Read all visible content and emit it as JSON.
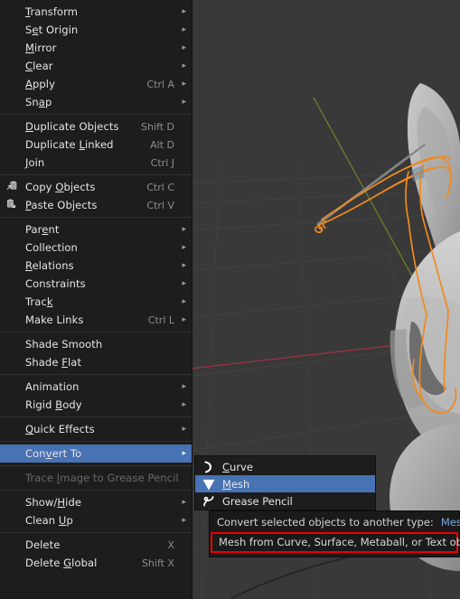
{
  "app": "Blender 3D Viewport - Object menu",
  "viewport": {
    "name": "3d-viewport",
    "background_color": "#393939",
    "grid_color": "#4a4a4a",
    "x_axis_color": "#a33a47",
    "y_axis_color": "#6b7a2a",
    "mesh_color": "#b6b6b6",
    "selection_outline_color": "#f08a1e"
  },
  "menu": {
    "name": "object-context-menu",
    "groups": [
      {
        "items": [
          {
            "label_pre": "",
            "mnemonic": "T",
            "label_post": "ransform",
            "shortcut": "",
            "arrow": true,
            "icon": "",
            "disabled": false,
            "selected": false
          },
          {
            "label_pre": "S",
            "mnemonic": "e",
            "label_post": "t Origin",
            "shortcut": "",
            "arrow": true,
            "icon": "",
            "disabled": false,
            "selected": false
          },
          {
            "label_pre": "",
            "mnemonic": "M",
            "label_post": "irror",
            "shortcut": "",
            "arrow": true,
            "icon": "",
            "disabled": false,
            "selected": false
          },
          {
            "label_pre": "",
            "mnemonic": "C",
            "label_post": "lear",
            "shortcut": "",
            "arrow": true,
            "icon": "",
            "disabled": false,
            "selected": false
          },
          {
            "label_pre": "",
            "mnemonic": "A",
            "label_post": "pply",
            "shortcut": "Ctrl A",
            "arrow": true,
            "icon": "",
            "disabled": false,
            "selected": false
          },
          {
            "label_pre": "Sn",
            "mnemonic": "a",
            "label_post": "p",
            "shortcut": "",
            "arrow": true,
            "icon": "",
            "disabled": false,
            "selected": false
          }
        ]
      },
      {
        "items": [
          {
            "label_pre": "",
            "mnemonic": "D",
            "label_post": "uplicate Objects",
            "shortcut": "Shift D",
            "arrow": false,
            "icon": "",
            "disabled": false,
            "selected": false
          },
          {
            "label_pre": "Duplicate ",
            "mnemonic": "L",
            "label_post": "inked",
            "shortcut": "Alt D",
            "arrow": false,
            "icon": "",
            "disabled": false,
            "selected": false
          },
          {
            "label_pre": "",
            "mnemonic": "J",
            "label_post": "oin",
            "shortcut": "Ctrl J",
            "arrow": false,
            "icon": "",
            "disabled": false,
            "selected": false
          }
        ]
      },
      {
        "items": [
          {
            "label_pre": "Copy ",
            "mnemonic": "O",
            "label_post": "bjects",
            "shortcut": "Ctrl C",
            "arrow": false,
            "icon": "copy-icon",
            "disabled": false,
            "selected": false
          },
          {
            "label_pre": "",
            "mnemonic": "P",
            "label_post": "aste Objects",
            "shortcut": "Ctrl V",
            "arrow": false,
            "icon": "paste-icon",
            "disabled": false,
            "selected": false
          }
        ]
      },
      {
        "items": [
          {
            "label_pre": "Par",
            "mnemonic": "e",
            "label_post": "nt",
            "shortcut": "",
            "arrow": true,
            "icon": "",
            "disabled": false,
            "selected": false
          },
          {
            "label_pre": "Collection",
            "mnemonic": "",
            "label_post": "",
            "shortcut": "",
            "arrow": true,
            "icon": "",
            "disabled": false,
            "selected": false
          },
          {
            "label_pre": "",
            "mnemonic": "R",
            "label_post": "elations",
            "shortcut": "",
            "arrow": true,
            "icon": "",
            "disabled": false,
            "selected": false
          },
          {
            "label_pre": "Constraints",
            "mnemonic": "",
            "label_post": "",
            "shortcut": "",
            "arrow": true,
            "icon": "",
            "disabled": false,
            "selected": false
          },
          {
            "label_pre": "Trac",
            "mnemonic": "k",
            "label_post": "",
            "shortcut": "",
            "arrow": true,
            "icon": "",
            "disabled": false,
            "selected": false
          },
          {
            "label_pre": "Make Links",
            "mnemonic": "",
            "label_post": "",
            "shortcut": "Ctrl L",
            "arrow": true,
            "icon": "",
            "disabled": false,
            "selected": false
          }
        ]
      },
      {
        "items": [
          {
            "label_pre": "Shade Smooth",
            "mnemonic": "",
            "label_post": "",
            "shortcut": "",
            "arrow": false,
            "icon": "",
            "disabled": false,
            "selected": false
          },
          {
            "label_pre": "Shade ",
            "mnemonic": "F",
            "label_post": "lat",
            "shortcut": "",
            "arrow": false,
            "icon": "",
            "disabled": false,
            "selected": false
          }
        ]
      },
      {
        "items": [
          {
            "label_pre": "Animation",
            "mnemonic": "",
            "label_post": "",
            "shortcut": "",
            "arrow": true,
            "icon": "",
            "disabled": false,
            "selected": false
          },
          {
            "label_pre": "Rigid ",
            "mnemonic": "B",
            "label_post": "ody",
            "shortcut": "",
            "arrow": true,
            "icon": "",
            "disabled": false,
            "selected": false
          }
        ]
      },
      {
        "items": [
          {
            "label_pre": "",
            "mnemonic": "Q",
            "label_post": "uick Effects",
            "shortcut": "",
            "arrow": true,
            "icon": "",
            "disabled": false,
            "selected": false
          }
        ]
      },
      {
        "items": [
          {
            "label_pre": "Con",
            "mnemonic": "v",
            "label_post": "ert To",
            "shortcut": "",
            "arrow": true,
            "icon": "",
            "disabled": false,
            "selected": true
          }
        ]
      },
      {
        "items": [
          {
            "label_pre": "Trace ",
            "mnemonic": "I",
            "label_post": "mage to Grease Pencil",
            "shortcut": "",
            "arrow": false,
            "icon": "",
            "disabled": true,
            "selected": false
          }
        ]
      },
      {
        "items": [
          {
            "label_pre": "Show/",
            "mnemonic": "H",
            "label_post": "ide",
            "shortcut": "",
            "arrow": true,
            "icon": "",
            "disabled": false,
            "selected": false
          },
          {
            "label_pre": "Clean ",
            "mnemonic": "U",
            "label_post": "p",
            "shortcut": "",
            "arrow": true,
            "icon": "",
            "disabled": false,
            "selected": false
          }
        ]
      },
      {
        "items": [
          {
            "label_pre": "Delete",
            "mnemonic": "",
            "label_post": "",
            "shortcut": "X",
            "arrow": false,
            "icon": "",
            "disabled": false,
            "selected": false
          },
          {
            "label_pre": "Delete ",
            "mnemonic": "G",
            "label_post": "lobal",
            "shortcut": "Shift X",
            "arrow": false,
            "icon": "",
            "disabled": false,
            "selected": false
          }
        ]
      }
    ]
  },
  "submenu": {
    "name": "convert-to-submenu",
    "items": [
      {
        "label_pre": "",
        "mnemonic": "C",
        "label_post": "urve",
        "icon": "curve-icon",
        "selected": false
      },
      {
        "label_pre": "",
        "mnemonic": "M",
        "label_post": "esh",
        "icon": "mesh-cone-icon",
        "selected": true
      },
      {
        "label_pre": "Grease Pencil",
        "mnemonic": "",
        "label_post": "",
        "icon": "grease-pencil-icon",
        "selected": false
      }
    ]
  },
  "tooltip": {
    "name": "mesh-tooltip",
    "description": "Convert selected objects to another type:",
    "value": "Mesh",
    "detail": "Mesh from Curve, Surface, Metaball, or Text objects",
    "highlight_color": "#ef0000"
  }
}
